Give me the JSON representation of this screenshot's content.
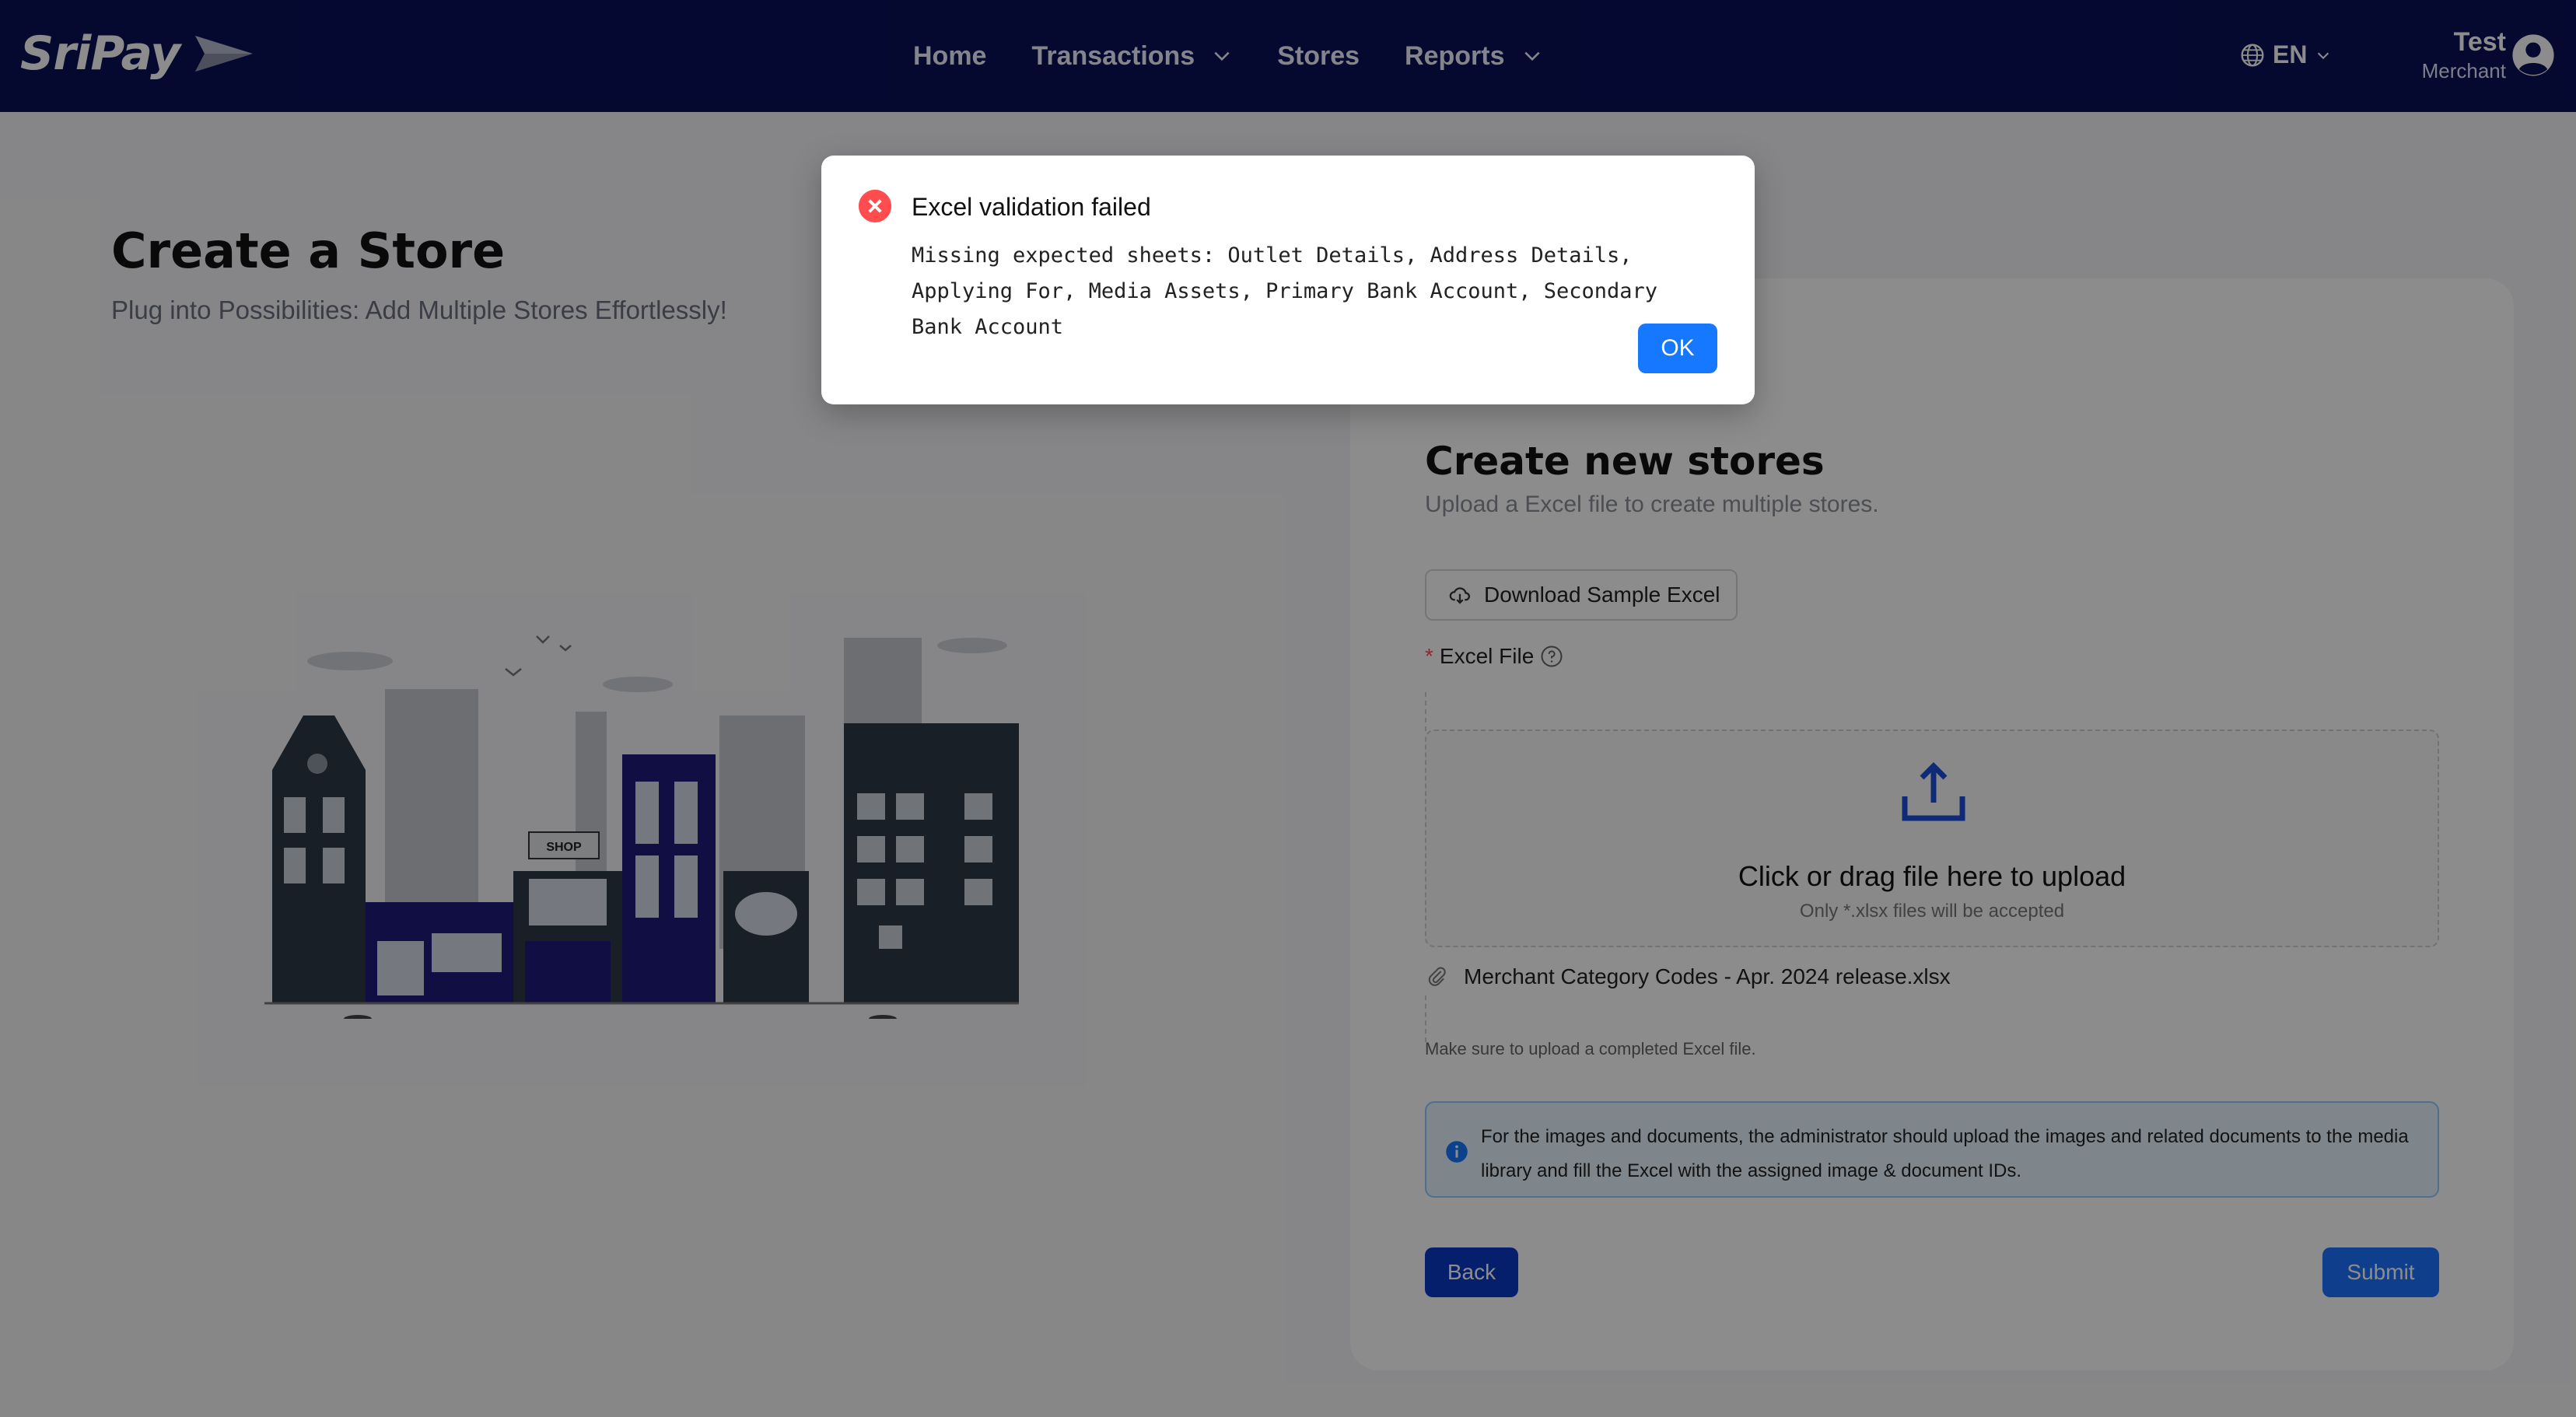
{
  "app": {
    "logo_text": "SriPay"
  },
  "nav": {
    "items": [
      {
        "label": "Home",
        "has_dropdown": false
      },
      {
        "label": "Transactions",
        "has_dropdown": true
      },
      {
        "label": "Stores",
        "has_dropdown": false
      },
      {
        "label": "Reports",
        "has_dropdown": true
      }
    ],
    "language": "EN",
    "user_name": "Test",
    "user_role": "Merchant"
  },
  "page": {
    "title": "Create a Store",
    "subtitle": "Plug into Possibilities: Add Multiple Stores Effortlessly!"
  },
  "illustration": {
    "shop_sign": "SHOP",
    "icon": "city-street-illustration"
  },
  "card": {
    "title": "Create new stores",
    "subtitle": "Upload a Excel file to create multiple stores.",
    "download_label": "Download Sample Excel",
    "field_label": "Excel File",
    "required_mark": "*",
    "dropzone_title": "Click or drag file here to upload",
    "dropzone_hint": "Only *.xlsx files will be accepted",
    "file_name": "Merchant Category Codes - Apr. 2024 release.xlsx",
    "help_text": "Make sure to upload a completed Excel file.",
    "info_text": "For the images and documents, the administrator should upload the images and related documents to the media library and fill the Excel with the assigned image & document IDs.",
    "back_label": "Back",
    "submit_label": "Submit"
  },
  "modal": {
    "title": "Excel validation failed",
    "message": "Missing expected sheets: Outlet Details, Address Details, Applying For, Media Assets, Primary Bank Account, Secondary Bank Account",
    "ok_label": "OK",
    "icon": "error-circle-icon"
  },
  "colors": {
    "navbar": "#0a0f57",
    "primary": "#1677ff",
    "back_button": "#0b3ac7",
    "error": "#ff4d4f",
    "info_bg": "#e6f4ff"
  }
}
